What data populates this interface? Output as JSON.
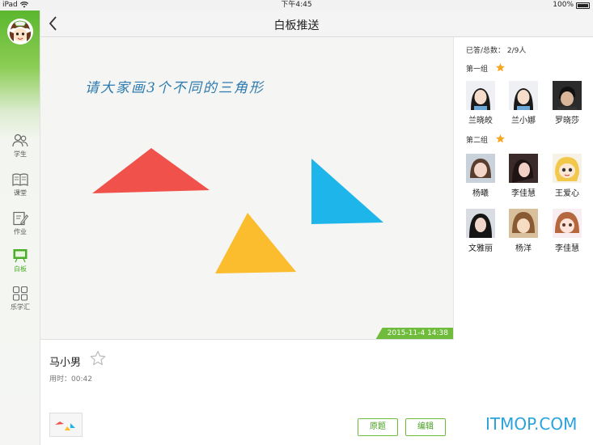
{
  "status_bar": {
    "device": "iPad",
    "time": "下午4:45",
    "battery": "100%"
  },
  "header": {
    "title": "白板推送"
  },
  "sidebar": {
    "items": [
      {
        "label": "学生",
        "icon": "students-icon"
      },
      {
        "label": "课堂",
        "icon": "book-icon"
      },
      {
        "label": "作业",
        "icon": "homework-icon"
      },
      {
        "label": "白板",
        "icon": "whiteboard-icon",
        "active": true
      },
      {
        "label": "乐学汇",
        "icon": "grid-icon"
      }
    ]
  },
  "board": {
    "prompt": "请大家画3个不同的三角形",
    "date": "2015-11-4  14:38",
    "colors": {
      "red": "#f0514a",
      "blue": "#1eb6ea",
      "yellow": "#fbbc2d"
    }
  },
  "student_info": {
    "name": "马小男",
    "time_used": "用时：00:42",
    "original_button": "原题",
    "edit_button": "编辑"
  },
  "panel": {
    "count": "已答/总数：  2/9人",
    "groups": [
      {
        "title": "第一组",
        "students": [
          "兰晓皎",
          "兰小娜",
          "罗晓莎"
        ]
      },
      {
        "title": "第二组",
        "students": [
          "杨曦",
          "李佳慧",
          "王爱心",
          "文雅丽",
          "杨洋",
          "李佳慧"
        ]
      }
    ]
  },
  "watermark": "ITMOP.COM",
  "colors": {
    "accent": "#6fbb3c",
    "star": "#f5a623"
  }
}
